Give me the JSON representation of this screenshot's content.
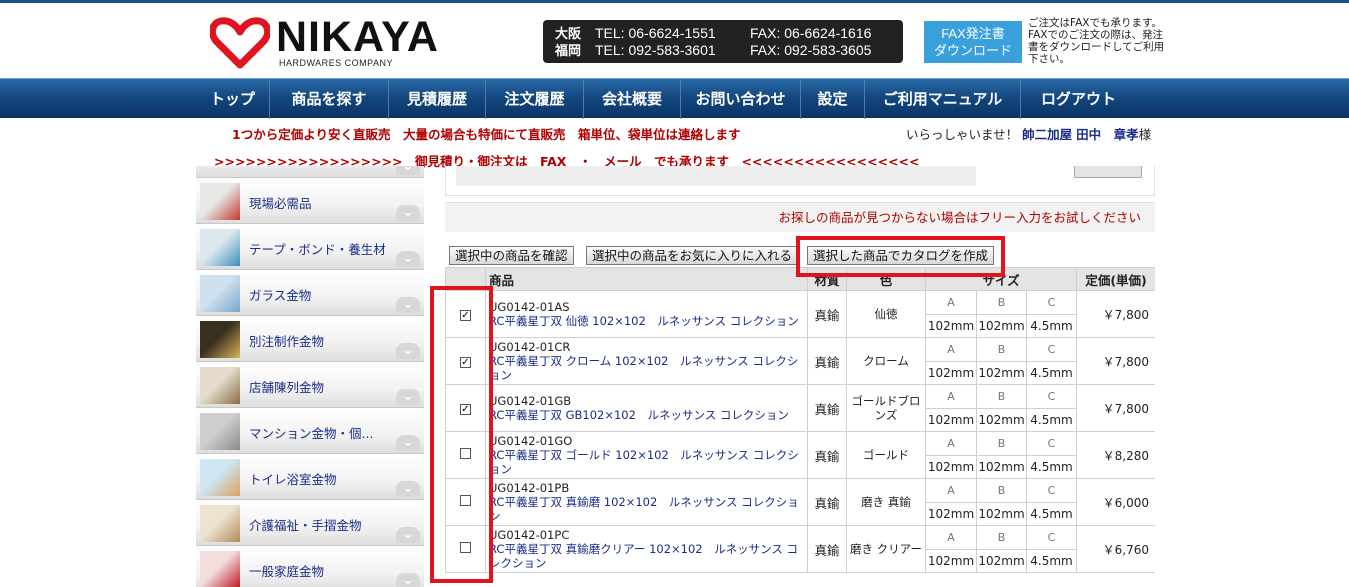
{
  "brand": {
    "name": "NIKAYA",
    "subtitle": "HARDWARES COMPANY",
    "accent_color": "#e0141e"
  },
  "contact": {
    "osaka": {
      "city": "大阪",
      "tel": "TEL: 06-6624-1551",
      "fax": "FAX: 06-6624-1616"
    },
    "fukuoka": {
      "city": "福岡",
      "tel": "TEL: 092-583-3601",
      "fax": "FAX: 092-583-3605"
    }
  },
  "fax_order": {
    "button_line1": "FAX発注書",
    "button_line2": "ダウンロード",
    "note": "ご注文はFAXでも承ります。FAXでのご注文の際は、発注書をダウンロードしてご利用下さい。"
  },
  "nav": {
    "items": [
      "トップ",
      "商品を探す",
      "見積履歴",
      "注文履歴",
      "会社概要",
      "お問い合わせ",
      "設定",
      "ご利用マニュアル",
      "ログアウト"
    ]
  },
  "promo": {
    "line1": "1つから定価より安く直販売　大量の場合も特価にて直販売　箱単位、袋単位は連絡します",
    "line2": ">>>>>>>>>>>>>>>>>>　御見積り・御注文は　FAX　・　メール　でも承ります　<<<<<<<<<<<<<<<<<"
  },
  "welcome": {
    "prefix": "いらっしゃいませ！",
    "company": "帥二加屋",
    "user": "田中　章孝",
    "suffix": "様"
  },
  "sidebar": {
    "categories": [
      {
        "label": "現場必需品",
        "icon": "fire-extinguisher-icon"
      },
      {
        "label": "テープ・ボンド・養生材",
        "icon": "tape-icon"
      },
      {
        "label": "ガラス金物",
        "icon": "glass-hardware-icon"
      },
      {
        "label": "別注制作金物",
        "icon": "custom-hardware-icon"
      },
      {
        "label": "店舗陳列金物",
        "icon": "store-display-icon"
      },
      {
        "label": "マンション金物・個...",
        "icon": "mailbox-icon"
      },
      {
        "label": "トイレ浴室金物",
        "icon": "bathroom-icon"
      },
      {
        "label": "介護福祉・手摺金物",
        "icon": "handrail-icon"
      },
      {
        "label": "一般家庭金物",
        "icon": "household-icon"
      }
    ]
  },
  "main": {
    "hint": "お探しの商品が見つからない場合はフリー入力をお試しください",
    "buttons": {
      "confirm": "選択中の商品を確認",
      "favorite": "選択中の商品をお気に入りに入れる",
      "catalog": "選択した商品でカタログを作成"
    },
    "table": {
      "headers": {
        "product": "商品",
        "material": "材質",
        "color": "色",
        "size": "サイズ",
        "price": "定価(単価)"
      },
      "size_labels": [
        "A",
        "B",
        "C"
      ],
      "rows": [
        {
          "checked": true,
          "code": "UG0142-01AS",
          "title": "RC平義星丁双 仙徳 102×102　ルネッサンス コレクション",
          "material": "真鍮",
          "color": "仙徳",
          "a": "102mm",
          "b": "102mm",
          "c": "4.5mm",
          "price": "￥7,800"
        },
        {
          "checked": true,
          "code": "UG0142-01CR",
          "title": "RC平義星丁双 クローム 102×102　ルネッサンス コレクション",
          "material": "真鍮",
          "color": "クローム",
          "a": "102mm",
          "b": "102mm",
          "c": "4.5mm",
          "price": "￥7,800"
        },
        {
          "checked": true,
          "code": "UG0142-01GB",
          "title": "RC平義星丁双 GB102×102　ルネッサンス コレクション",
          "material": "真鍮",
          "color": "ゴールドブロンズ",
          "a": "102mm",
          "b": "102mm",
          "c": "4.5mm",
          "price": "￥7,800"
        },
        {
          "checked": false,
          "code": "UG0142-01GO",
          "title": "RC平義星丁双 ゴールド 102×102　ルネッサンス コレクション",
          "material": "真鍮",
          "color": "ゴールド",
          "a": "102mm",
          "b": "102mm",
          "c": "4.5mm",
          "price": "￥8,280"
        },
        {
          "checked": false,
          "code": "UG0142-01PB",
          "title": "RC平義星丁双 真鍮磨 102×102　ルネッサンス コレクション",
          "material": "真鍮",
          "color": "磨き 真鍮",
          "a": "102mm",
          "b": "102mm",
          "c": "4.5mm",
          "price": "￥6,000"
        },
        {
          "checked": false,
          "code": "UG0142-01PC",
          "title": "RC平義星丁双 真鍮磨クリアー 102×102　ルネッサンス コレクション",
          "material": "真鍮",
          "color": "磨き クリアー",
          "a": "102mm",
          "b": "102mm",
          "c": "4.5mm",
          "price": "￥6,760"
        }
      ]
    }
  }
}
